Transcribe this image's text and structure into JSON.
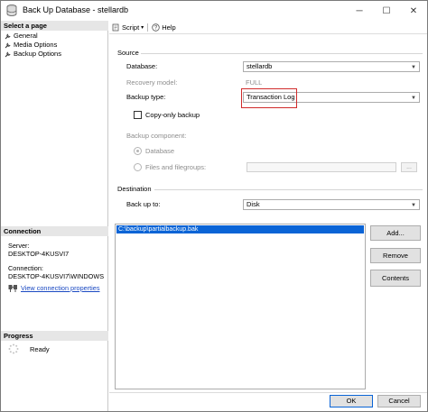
{
  "window": {
    "title": "Back Up Database - stellardb",
    "minimize": "─",
    "maximize": "☐",
    "close": "✕"
  },
  "left_pane": {
    "select_page_header": "Select a page",
    "pages": [
      {
        "label": "General",
        "icon": "wrench-icon"
      },
      {
        "label": "Media Options",
        "icon": "wrench-icon"
      },
      {
        "label": "Backup Options",
        "icon": "wrench-icon"
      }
    ],
    "connection_header": "Connection",
    "server_label": "Server:",
    "server_value": "DESKTOP-4KUSVI7",
    "connection_label": "Connection:",
    "connection_value": "DESKTOP-4KUSVI7\\WINDOWS",
    "view_connection_link": "View connection properties",
    "progress_header": "Progress",
    "progress_status": "Ready"
  },
  "toolbar": {
    "script_label": "Script",
    "help_label": "Help"
  },
  "source": {
    "section_title": "Source",
    "database_label": "Database:",
    "database_value": "stellardb",
    "recovery_model_label": "Recovery model:",
    "recovery_model_value": "FULL",
    "backup_type_label": "Backup type:",
    "backup_type_value": "Transaction Log",
    "copy_only_label": "Copy-only backup",
    "backup_component_label": "Backup component:",
    "component_database_label": "Database",
    "component_files_label": "Files and filegroups:",
    "browse_label": "..."
  },
  "destination": {
    "section_title": "Destination",
    "back_up_to_label": "Back up to:",
    "back_up_to_value": "Disk",
    "paths": [
      "C:\\backup\\partialbackup.bak"
    ],
    "add_button": "Add...",
    "remove_button": "Remove",
    "contents_button": "Contents"
  },
  "footer": {
    "ok_button": "OK",
    "cancel_button": "Cancel"
  },
  "colors": {
    "selection": "#0a64d6",
    "highlight_box": "#d02b2b",
    "link": "#1a49c2"
  }
}
